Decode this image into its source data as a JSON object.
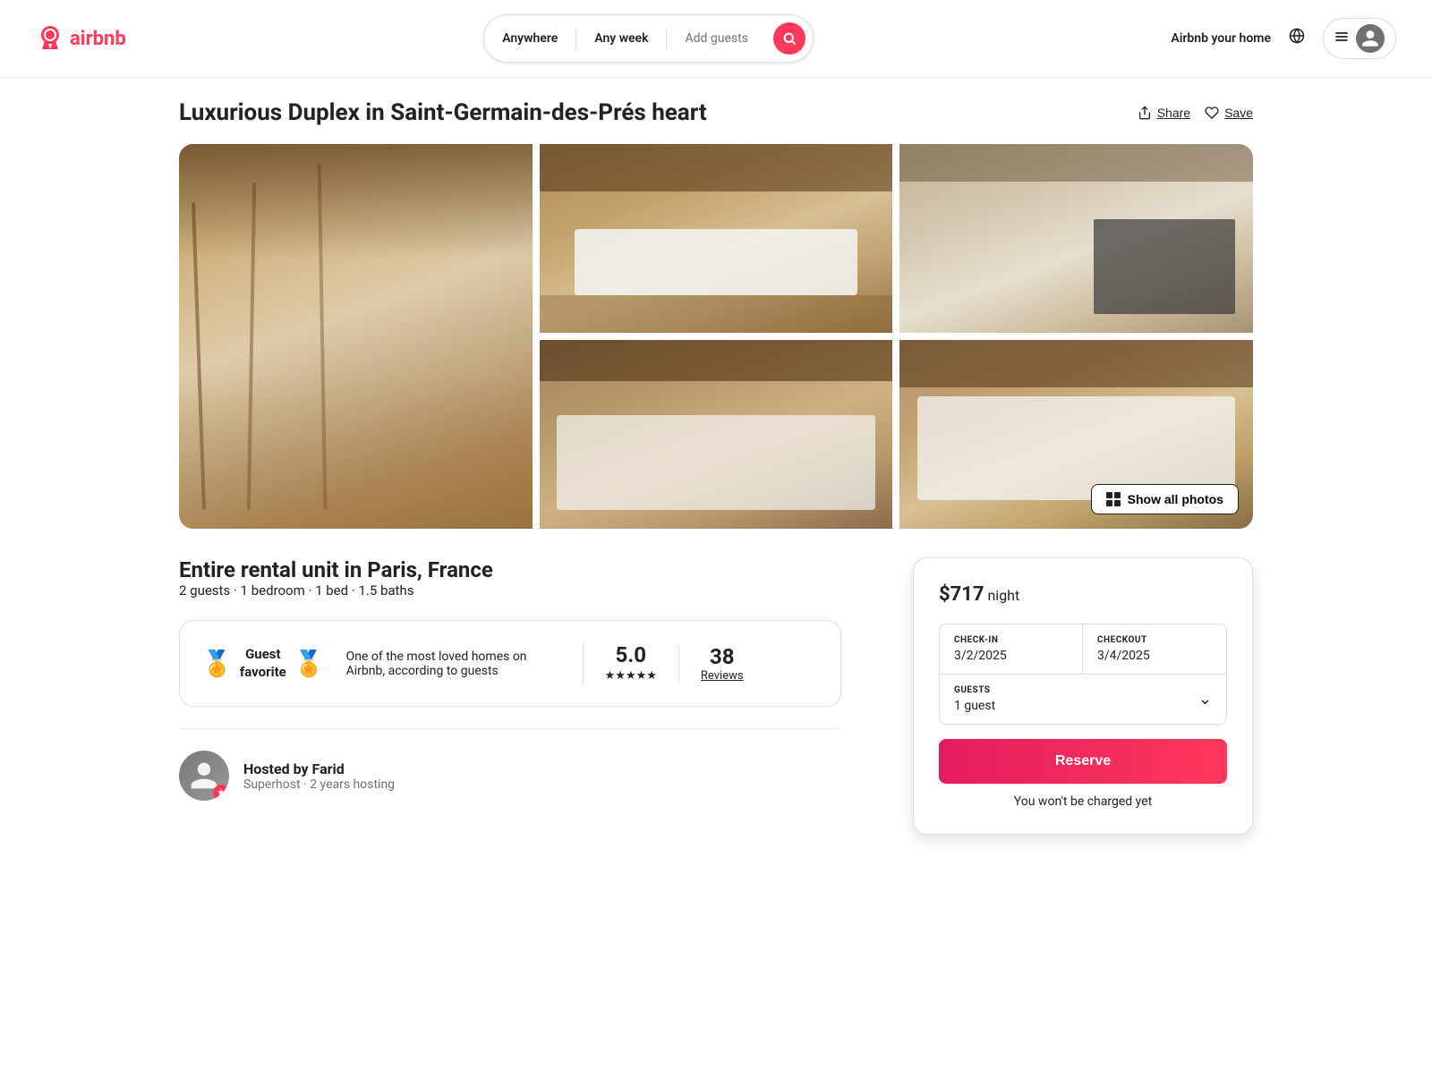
{
  "header": {
    "logo_text": "airbnb",
    "search": {
      "anywhere": "Anywhere",
      "any_week": "Any week",
      "add_guests": "Add guests"
    },
    "airbnb_home": "Airbnb your home"
  },
  "listing": {
    "title": "Luxurious Duplex in Saint-Germain-des-Prés heart",
    "actions": {
      "share": "Share",
      "save": "Save"
    },
    "photos": {
      "show_all": "Show all photos"
    },
    "subtitle": "Entire rental unit in Paris, France",
    "meta": "2 guests · 1 bedroom · 1 bed · 1.5 baths",
    "guest_favorite": {
      "title": "Guest\nfavorite",
      "description": "One of the most loved homes on Airbnb, according to guests",
      "rating": "5.0",
      "stars": "★★★★★",
      "reviews_count": "38",
      "reviews_label": "Reviews"
    },
    "host": {
      "label": "Hosted by",
      "name": "Farid",
      "superhost": "Superhost",
      "years": "2 years hosting"
    }
  },
  "booking": {
    "price": "$717",
    "per_night": "night",
    "checkin_label": "CHECK-IN",
    "checkin_value": "3/2/2025",
    "checkout_label": "CHECKOUT",
    "checkout_value": "3/4/2025",
    "guests_label": "GUESTS",
    "guests_value": "1 guest",
    "reserve_label": "Reserve",
    "no_charge": "You won't be charged yet"
  }
}
